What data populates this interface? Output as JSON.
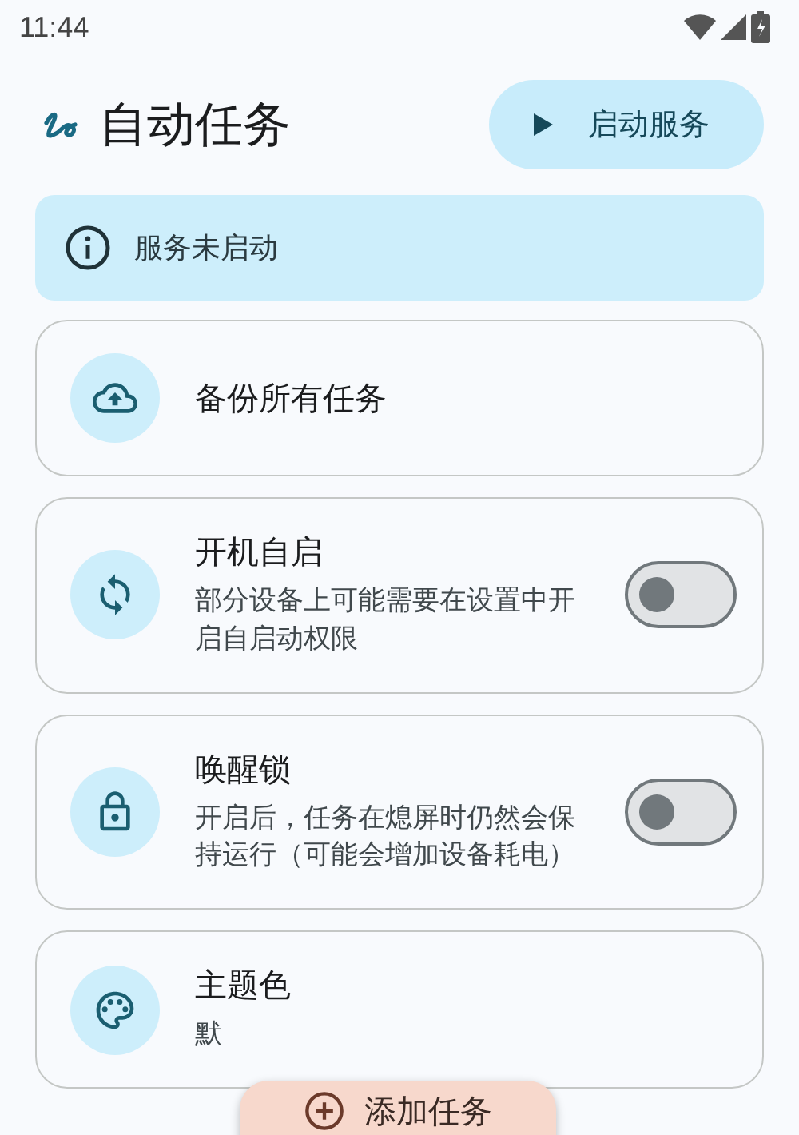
{
  "status_bar": {
    "time": "11:44"
  },
  "header": {
    "title": "自动任务",
    "action": {
      "label": "启动服务"
    }
  },
  "banner": {
    "text": "服务未启动"
  },
  "settings": [
    {
      "kind": "action",
      "title": "备份所有任务"
    },
    {
      "kind": "switch",
      "title": "开机自启",
      "subtitle": "部分设备上可能需要在设置中开启自启动权限",
      "on": false
    },
    {
      "kind": "switch",
      "title": "唤醒锁",
      "subtitle": "开启后，任务在熄屏时仍然会保持运行（可能会增加设备耗电）",
      "on": false
    },
    {
      "kind": "value",
      "title": "主题色",
      "subtitle": "默"
    }
  ],
  "fab": {
    "label": "添加任务"
  }
}
